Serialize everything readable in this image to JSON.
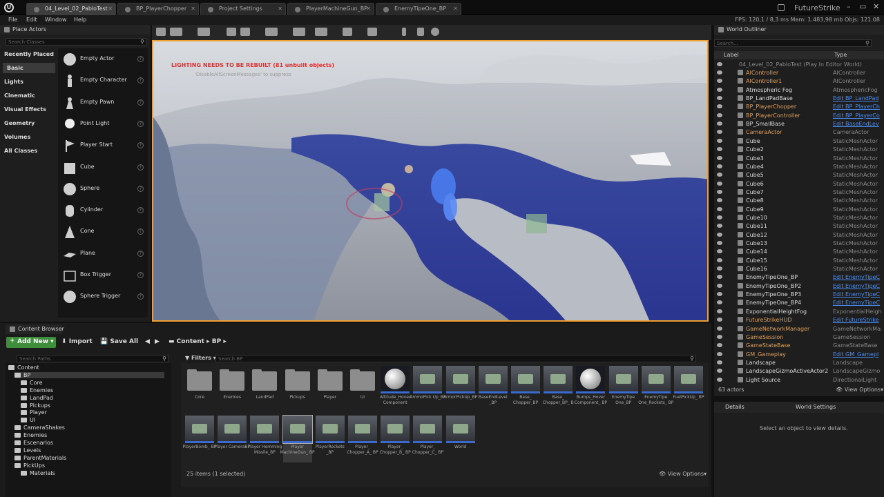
{
  "tabs": [
    {
      "label": "04_Level_02_PabloTest",
      "active": true
    },
    {
      "label": "BP_PlayerChopper"
    },
    {
      "label": "Project Settings"
    },
    {
      "label": "PlayerMachineGun_BP"
    },
    {
      "label": "EnemyTipeOne_BP"
    }
  ],
  "project_name": "FutureStrike",
  "menu": [
    "File",
    "Edit",
    "Window",
    "Help"
  ],
  "stats": "FPS: 120,1  /  8,3 ms  Mem: 1.483,98 mb  Objs: 121.08",
  "place_actors": {
    "title": "Place Actors",
    "search_placeholder": "Search Classes",
    "categories": [
      "Recently Placed",
      "Basic",
      "Lights",
      "Cinematic",
      "Visual Effects",
      "Geometry",
      "Volumes",
      "All Classes"
    ],
    "selected_category": "Basic",
    "items": [
      "Empty Actor",
      "Empty Character",
      "Empty Pawn",
      "Point Light",
      "Player Start",
      "Cube",
      "Sphere",
      "Cylinder",
      "Cone",
      "Plane",
      "Box Trigger",
      "Sphere Trigger"
    ]
  },
  "viewport": {
    "warning": "LIGHTING NEEDS TO BE REBUILT (81 unbuilt objects)",
    "suppress": "'DisableAllScreenMessages' to suppress"
  },
  "outliner": {
    "title": "World Outliner",
    "search_placeholder": "Search...",
    "col_label": "Label",
    "col_type": "Type",
    "root": "04_Level_02_PabloTest (Play In Editor World)",
    "rows": [
      {
        "name": "AIController",
        "type": "AIController",
        "link": false,
        "orange": true
      },
      {
        "name": "AIController1",
        "type": "AIController",
        "link": false,
        "orange": true
      },
      {
        "name": "Atmospheric Fog",
        "type": "AtmosphericFog",
        "link": false
      },
      {
        "name": "BP_LandPadBase",
        "type": "Edit BP_LandPad",
        "link": true
      },
      {
        "name": "BP_PlayerChopper",
        "type": "Edit BP_PlayerCh",
        "link": true,
        "orange": true
      },
      {
        "name": "BP_PlayerController",
        "type": "Edit BP_PlayerCo",
        "link": true,
        "orange": true
      },
      {
        "name": "BP_SmallBase",
        "type": "Edit BaseEndLev",
        "link": true
      },
      {
        "name": "CameraActor",
        "type": "CameraActor",
        "link": false,
        "orange": true
      },
      {
        "name": "Cube",
        "type": "StaticMeshActor",
        "link": false
      },
      {
        "name": "Cube2",
        "type": "StaticMeshActor",
        "link": false
      },
      {
        "name": "Cube3",
        "type": "StaticMeshActor",
        "link": false
      },
      {
        "name": "Cube4",
        "type": "StaticMeshActor",
        "link": false
      },
      {
        "name": "Cube5",
        "type": "StaticMeshActor",
        "link": false
      },
      {
        "name": "Cube6",
        "type": "StaticMeshActor",
        "link": false
      },
      {
        "name": "Cube7",
        "type": "StaticMeshActor",
        "link": false
      },
      {
        "name": "Cube8",
        "type": "StaticMeshActor",
        "link": false
      },
      {
        "name": "Cube9",
        "type": "StaticMeshActor",
        "link": false
      },
      {
        "name": "Cube10",
        "type": "StaticMeshActor",
        "link": false
      },
      {
        "name": "Cube11",
        "type": "StaticMeshActor",
        "link": false
      },
      {
        "name": "Cube12",
        "type": "StaticMeshActor",
        "link": false
      },
      {
        "name": "Cube13",
        "type": "StaticMeshActor",
        "link": false
      },
      {
        "name": "Cube14",
        "type": "StaticMeshActor",
        "link": false
      },
      {
        "name": "Cube15",
        "type": "StaticMeshActor",
        "link": false
      },
      {
        "name": "Cube16",
        "type": "StaticMeshActor",
        "link": false
      },
      {
        "name": "EnemyTipeOne_BP",
        "type": "Edit EnemyTipeC",
        "link": true
      },
      {
        "name": "EnemyTipeOne_BP2",
        "type": "Edit EnemyTipeC",
        "link": true
      },
      {
        "name": "EnemyTipeOne_BP3",
        "type": "Edit EnemyTipeC",
        "link": true
      },
      {
        "name": "EnemyTipeOne_BP4",
        "type": "Edit EnemyTipeC",
        "link": true
      },
      {
        "name": "ExponentialHeightFog",
        "type": "ExponentialHeightFog",
        "link": false
      },
      {
        "name": "FutureStrikeHUD",
        "type": "Edit FutureStrike",
        "link": true,
        "orange": true
      },
      {
        "name": "GameNetworkManager",
        "type": "GameNetworkMan",
        "link": false,
        "orange": true
      },
      {
        "name": "GameSession",
        "type": "GameSession",
        "link": false,
        "orange": true
      },
      {
        "name": "GameStateBase",
        "type": "GameStateBase",
        "link": false,
        "orange": true
      },
      {
        "name": "GM_Gameplay",
        "type": "Edit GM_Gamepl",
        "link": true,
        "orange": true
      },
      {
        "name": "Landscape",
        "type": "Landscape",
        "link": false
      },
      {
        "name": "LandscapeGizmoActiveActor2",
        "type": "LandscapeGizmo",
        "link": false
      },
      {
        "name": "Light Source",
        "type": "DirectionalLight",
        "link": false
      }
    ],
    "count": "63 actors",
    "view_options": "View Options"
  },
  "details": {
    "tab1": "Details",
    "tab2": "World Settings",
    "empty": "Select an object to view details."
  },
  "content_browser": {
    "title": "Content Browser",
    "add_new": "Add New",
    "import": "Import",
    "save_all": "Save All",
    "path": [
      "Content",
      "BP"
    ],
    "search_paths": "Search Paths",
    "filters": "Filters",
    "search_bp": "Search BP",
    "tree": [
      {
        "label": "Content",
        "indent": 0
      },
      {
        "label": "BP",
        "indent": 1,
        "selected": true
      },
      {
        "label": "Core",
        "indent": 2
      },
      {
        "label": "Enemies",
        "indent": 2
      },
      {
        "label": "LandPad",
        "indent": 2
      },
      {
        "label": "Pickups",
        "indent": 2
      },
      {
        "label": "Player",
        "indent": 2
      },
      {
        "label": "UI",
        "indent": 2
      },
      {
        "label": "CameraShakes",
        "indent": 1
      },
      {
        "label": "Enemies",
        "indent": 1
      },
      {
        "label": "Escenarios",
        "indent": 1
      },
      {
        "label": "Levels",
        "indent": 1
      },
      {
        "label": "ParentMaterials",
        "indent": 1
      },
      {
        "label": "PickUps",
        "indent": 1
      },
      {
        "label": "Materials",
        "indent": 2
      }
    ],
    "assets": [
      {
        "label": "Core",
        "kind": "folder"
      },
      {
        "label": "Enemies",
        "kind": "folder"
      },
      {
        "label": "LandPad",
        "kind": "folder"
      },
      {
        "label": "Pickups",
        "kind": "folder"
      },
      {
        "label": "Player",
        "kind": "folder"
      },
      {
        "label": "UI",
        "kind": "folder"
      },
      {
        "label": "Altitude_Hover Component",
        "kind": "sphere"
      },
      {
        "label": "AmmoPick Up_BP",
        "kind": "bp"
      },
      {
        "label": "ArmorPickUp_BP",
        "kind": "bp"
      },
      {
        "label": "BaseEndLevel _BP",
        "kind": "bp"
      },
      {
        "label": "Base_ Chopper_BP",
        "kind": "bp"
      },
      {
        "label": "Base_ Chopper_BP_ B",
        "kind": "bp"
      },
      {
        "label": "Bumps_Hover Component_ BP",
        "kind": "sphere"
      },
      {
        "label": "EnemyTipe One_BP",
        "kind": "bp"
      },
      {
        "label": "EnemyTipe One_Rockets_ BP",
        "kind": "bp"
      },
      {
        "label": "FuelPickUp_ BP",
        "kind": "bp"
      },
      {
        "label": "PlayerBomb_ BP",
        "kind": "bp"
      },
      {
        "label": "Player CameraBP",
        "kind": "bp"
      },
      {
        "label": "Player Homming Missile_BP",
        "kind": "bp"
      },
      {
        "label": "Player MachineGun_ BP",
        "kind": "bp",
        "selected": true
      },
      {
        "label": "PlayerRockets _BP",
        "kind": "bp"
      },
      {
        "label": "Player_ Chopper_A_ BP",
        "kind": "bp"
      },
      {
        "label": "Player_ Chopper_B_ BP",
        "kind": "bp"
      },
      {
        "label": "Player_ Chopper_C_ BP",
        "kind": "bp"
      },
      {
        "label": "World",
        "kind": "bp"
      }
    ],
    "status": "25 items (1 selected)",
    "view_options": "View Options"
  }
}
